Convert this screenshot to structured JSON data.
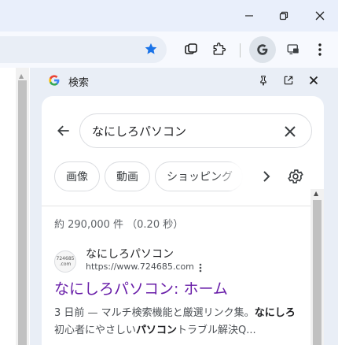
{
  "window": {
    "minimize_icon": "minimize-icon",
    "restore_icon": "restore-icon",
    "close_icon": "close-icon"
  },
  "toolbar": {
    "bookmark_icon": "star-filled-icon",
    "accent_color": "#1a73e8",
    "icons": [
      "tab-search-icon",
      "extensions-puzzle-icon",
      "google-lens-icon",
      "cast-icon",
      "more-vert-icon"
    ]
  },
  "side_panel": {
    "title": "検索",
    "icons": [
      "pin-icon",
      "open-in-new-tab-icon",
      "close-icon"
    ]
  },
  "search": {
    "query": "なにしろパソコン"
  },
  "chips": [
    {
      "label": "画像"
    },
    {
      "label": "動画"
    },
    {
      "label": "ショッピング"
    }
  ],
  "results": {
    "stats": "約 290,000 件  （0.20 秒）",
    "items": [
      {
        "favicon_text": "724685 .com",
        "site_name": "なにしろパソコン",
        "url": "https://www.724685.com",
        "title": "なにしろパソコン: ホーム",
        "title_color": "#681da8",
        "snippet_date": "3 日前 — ",
        "snippet_p1": "マルチ検索機能と厳選リンク集。",
        "snippet_b1": "なにしろ",
        "snippet_p2": "初心者にやさしい",
        "snippet_b2": "パソコン",
        "snippet_p3": "トラブル解決Q..."
      }
    ]
  }
}
